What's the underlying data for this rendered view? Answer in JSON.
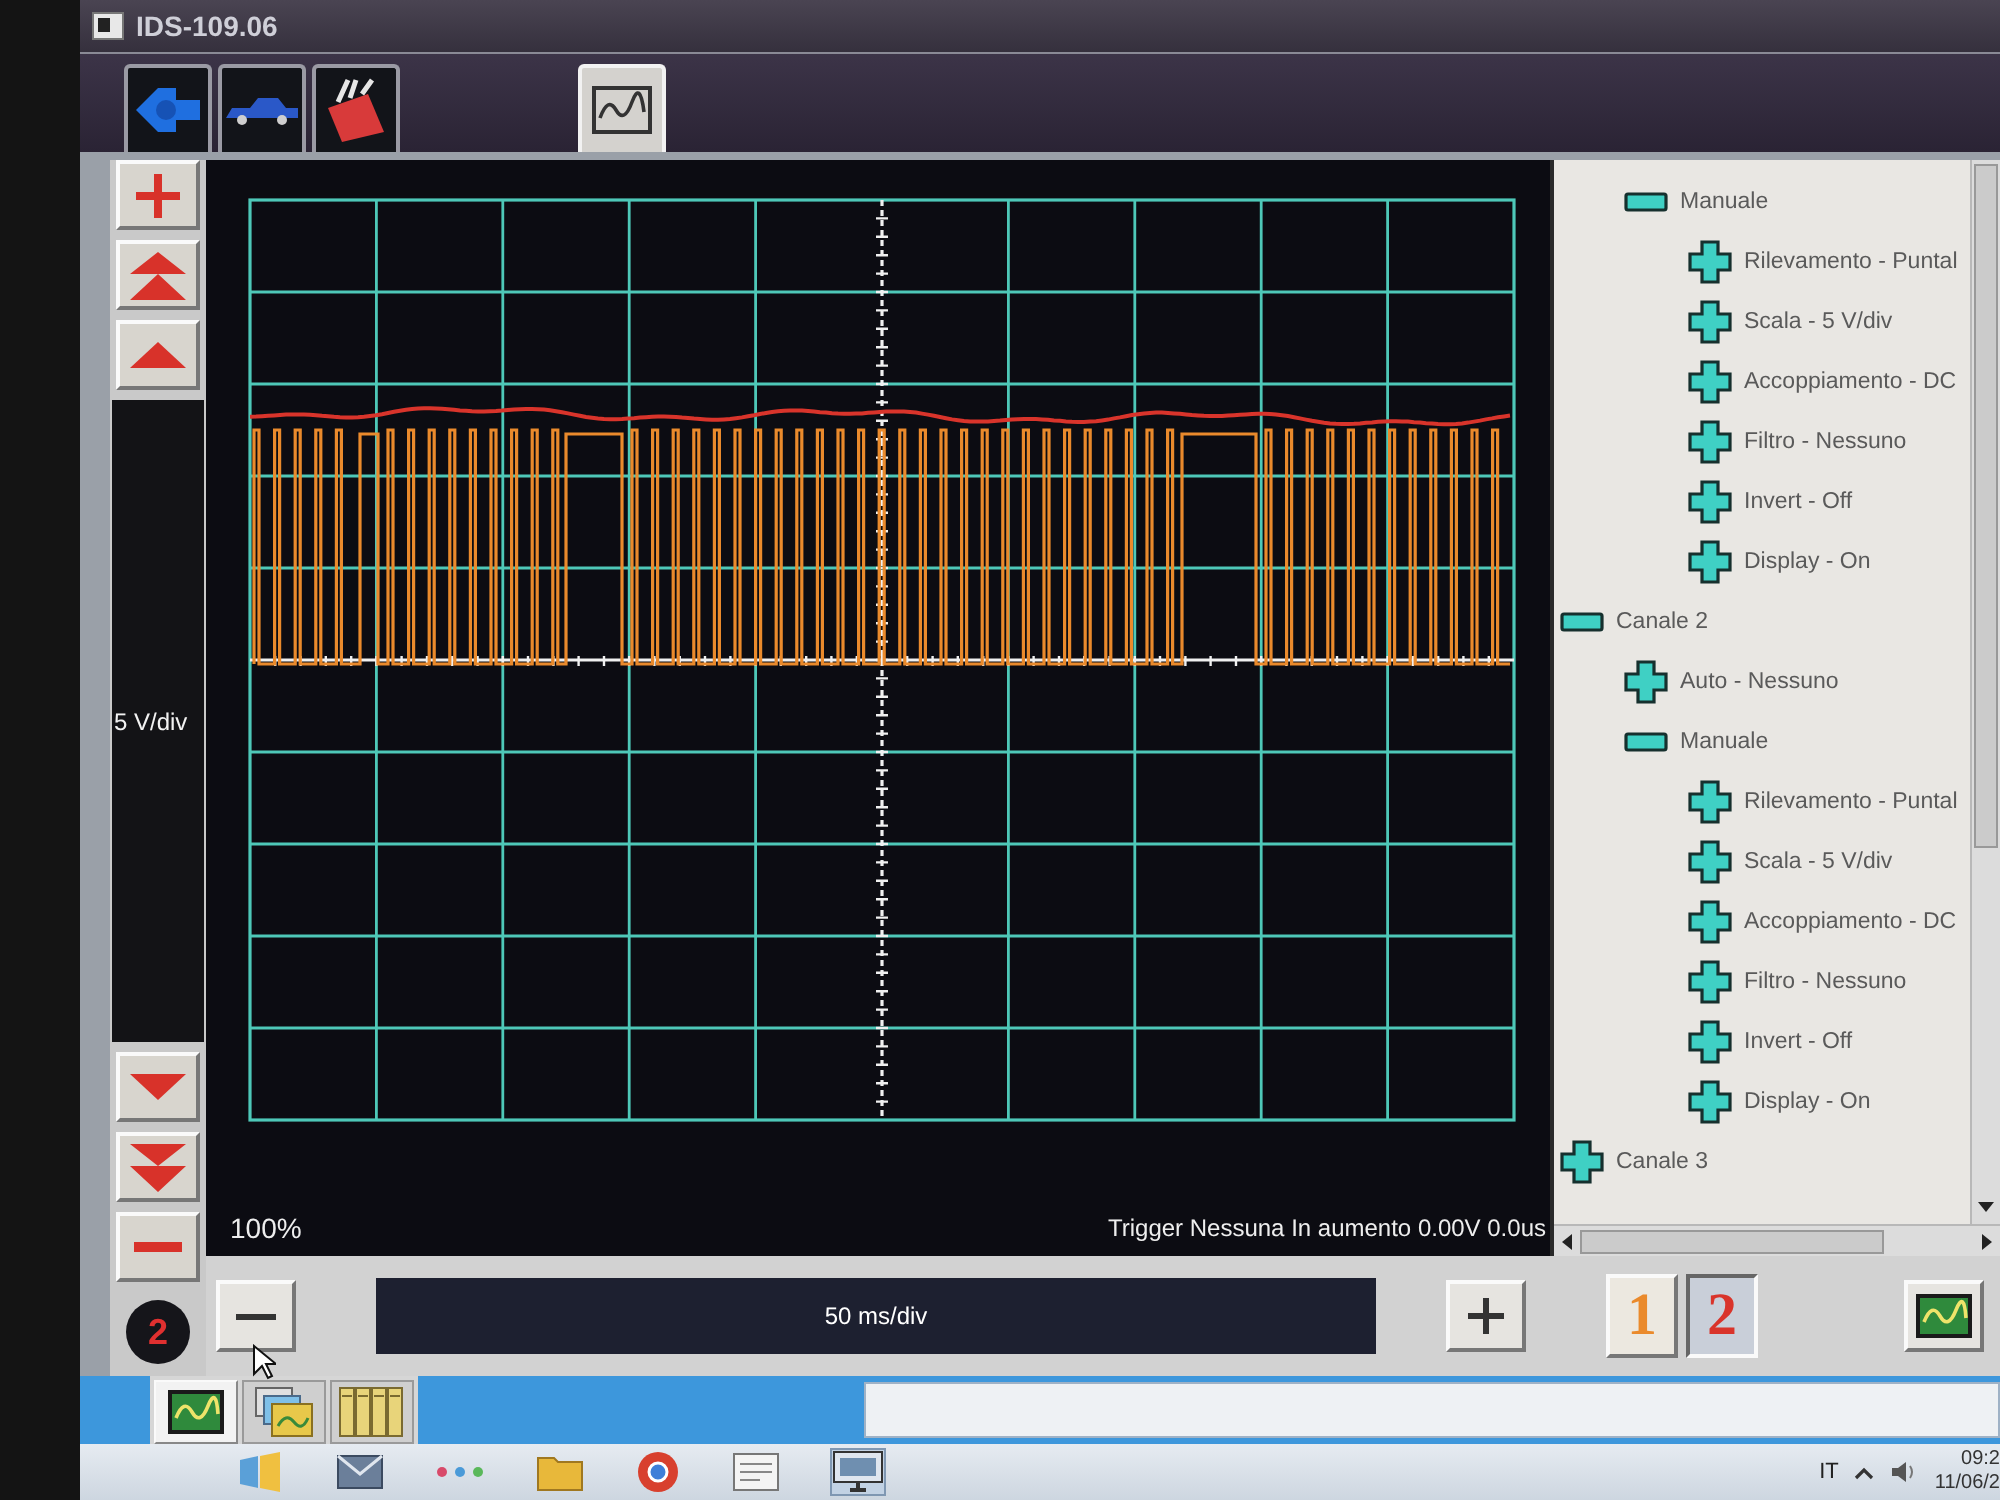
{
  "window": {
    "title": "IDS-109.06"
  },
  "top_tabs": [
    {
      "kind": "connector",
      "selected": false
    },
    {
      "kind": "car",
      "selected": false
    },
    {
      "kind": "toolbox",
      "selected": false
    },
    {
      "kind": "scope",
      "selected": true
    }
  ],
  "vertical": {
    "scale": "5 V/div",
    "channel": "2"
  },
  "scope": {
    "zoom": "100%",
    "trigger": "Trigger Nessuna In aumento 0.00V 0.0us"
  },
  "tree": {
    "items": [
      {
        "children": [
          {
            "label": "Manuale",
            "expanded": true,
            "children": [
              {
                "label": "Rilevamento - Puntal",
                "expanded": false
              },
              {
                "label": "Scala - 5 V/div",
                "expanded": false
              },
              {
                "label": "Accoppiamento - DC",
                "expanded": false
              },
              {
                "label": "Filtro - Nessuno",
                "expanded": false
              },
              {
                "label": "Invert - Off",
                "expanded": false
              },
              {
                "label": "Display - On",
                "expanded": false
              }
            ]
          }
        ]
      },
      {
        "label": "Canale 2",
        "expanded": true,
        "children": [
          {
            "label": "Auto - Nessuno",
            "expanded": false
          },
          {
            "label": "Manuale",
            "expanded": true,
            "children": [
              {
                "label": "Rilevamento - Puntal",
                "expanded": false
              },
              {
                "label": "Scala - 5 V/div",
                "expanded": false
              },
              {
                "label": "Accoppiamento - DC",
                "expanded": false
              },
              {
                "label": "Filtro - Nessuno",
                "expanded": false
              },
              {
                "label": "Invert - Off",
                "expanded": false
              },
              {
                "label": "Display - On",
                "expanded": false
              }
            ]
          }
        ]
      },
      {
        "label": "Canale 3",
        "expanded": false
      }
    ]
  },
  "timebase": {
    "label": "50 ms/div"
  },
  "channels": [
    {
      "label": "1",
      "color": "#ea8a2c",
      "selected": false
    },
    {
      "label": "2",
      "color": "#d9342b",
      "selected": true
    }
  ],
  "bottom_tabs": [
    {
      "kind": "scope",
      "selected": true
    },
    {
      "kind": "folders",
      "selected": false
    },
    {
      "kind": "cards",
      "selected": false
    }
  ],
  "taskbar": {
    "language": "IT",
    "time": "09:2",
    "date": "11/06/2"
  }
}
